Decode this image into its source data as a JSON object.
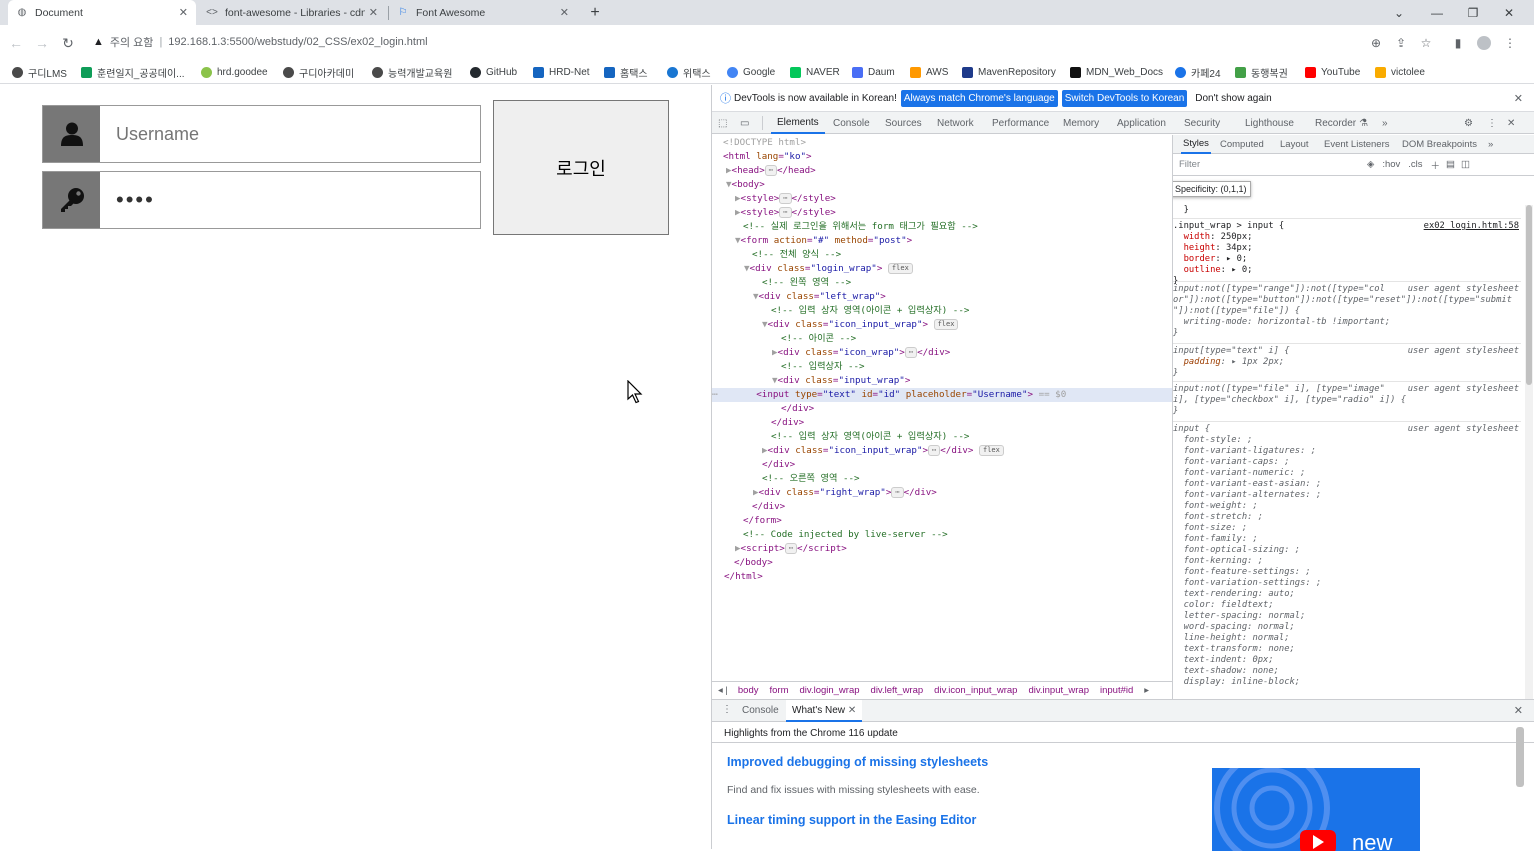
{
  "browser": {
    "tabs": [
      {
        "title": "Document",
        "icon": "globe-icon"
      },
      {
        "title": "font-awesome - Libraries - cdnj",
        "icon": "code-icon"
      },
      {
        "title": "Font Awesome",
        "icon": "flag-icon"
      }
    ],
    "new_tab": "+",
    "url_warning": "주의 요함",
    "url": "192.168.1.3:5500/webstudy/02_CSS/ex02_login.html",
    "bookmarks": [
      {
        "label": "구디LMS",
        "color": "#4a4a4a"
      },
      {
        "label": "훈련일지_공공데이...",
        "color": "#0f9d58"
      },
      {
        "label": "hrd.goodee",
        "color": "#8bc34a"
      },
      {
        "label": "구디아카데미",
        "color": "#4a4a4a"
      },
      {
        "label": "능력개발교육원",
        "color": "#4a4a4a"
      },
      {
        "label": "GitHub",
        "color": "#24292e"
      },
      {
        "label": "HRD-Net",
        "color": "#1565c0"
      },
      {
        "label": "홈택스",
        "color": "#1565c0"
      },
      {
        "label": "위택스",
        "color": "#1976d2"
      },
      {
        "label": "Google",
        "color": "#4285f4"
      },
      {
        "label": "NAVER",
        "color": "#03c75a"
      },
      {
        "label": "Daum",
        "color": "#4a6ef5"
      },
      {
        "label": "AWS",
        "color": "#ff9900"
      },
      {
        "label": "MavenRepository",
        "color": "#1e3a8a"
      },
      {
        "label": "MDN_Web_Docs",
        "color": "#111111"
      },
      {
        "label": "카페24",
        "color": "#1a73e8"
      },
      {
        "label": "동행복권",
        "color": "#43a047"
      },
      {
        "label": "YouTube",
        "color": "#ff0000"
      },
      {
        "label": "victolee",
        "color": "#f9ab00"
      }
    ]
  },
  "page": {
    "username_placeholder": "Username",
    "password_value": "pass",
    "login_label": "로그인",
    "user_icon": "user-icon",
    "key_icon": "key-icon"
  },
  "devtools": {
    "info_text": "DevTools is now available in Korean!",
    "info_btn1": "Always match Chrome's language",
    "info_btn2": "Switch DevTools to Korean",
    "info_dismiss": "Don't show again",
    "tabs": [
      "Elements",
      "Console",
      "Sources",
      "Network",
      "Performance",
      "Memory",
      "Application",
      "Security",
      "Lighthouse",
      "Recorder"
    ],
    "breadcrumbs": [
      "body",
      "form",
      "div.login_wrap",
      "div.left_wrap",
      "div.icon_input_wrap",
      "div.input_wrap",
      "input#id"
    ],
    "styles_tabs": [
      "Styles",
      "Computed",
      "Layout",
      "Event Listeners",
      "DOM Breakpoints"
    ],
    "filter_placeholder": "Filter",
    "filter_hov": ":hov",
    "filter_cls": ".cls",
    "tooltip": "Specificity: (0,1,1)",
    "drawer_tabs": [
      "Console",
      "What's New"
    ],
    "highlights": "Highlights from the Chrome 116 update",
    "whatsnew": [
      {
        "title": "Improved debugging of missing stylesheets",
        "desc": "Find and fix issues with missing stylesheets with ease."
      },
      {
        "title": "Linear timing support in the Easing Editor",
        "desc": ""
      }
    ],
    "video_text": "new"
  }
}
